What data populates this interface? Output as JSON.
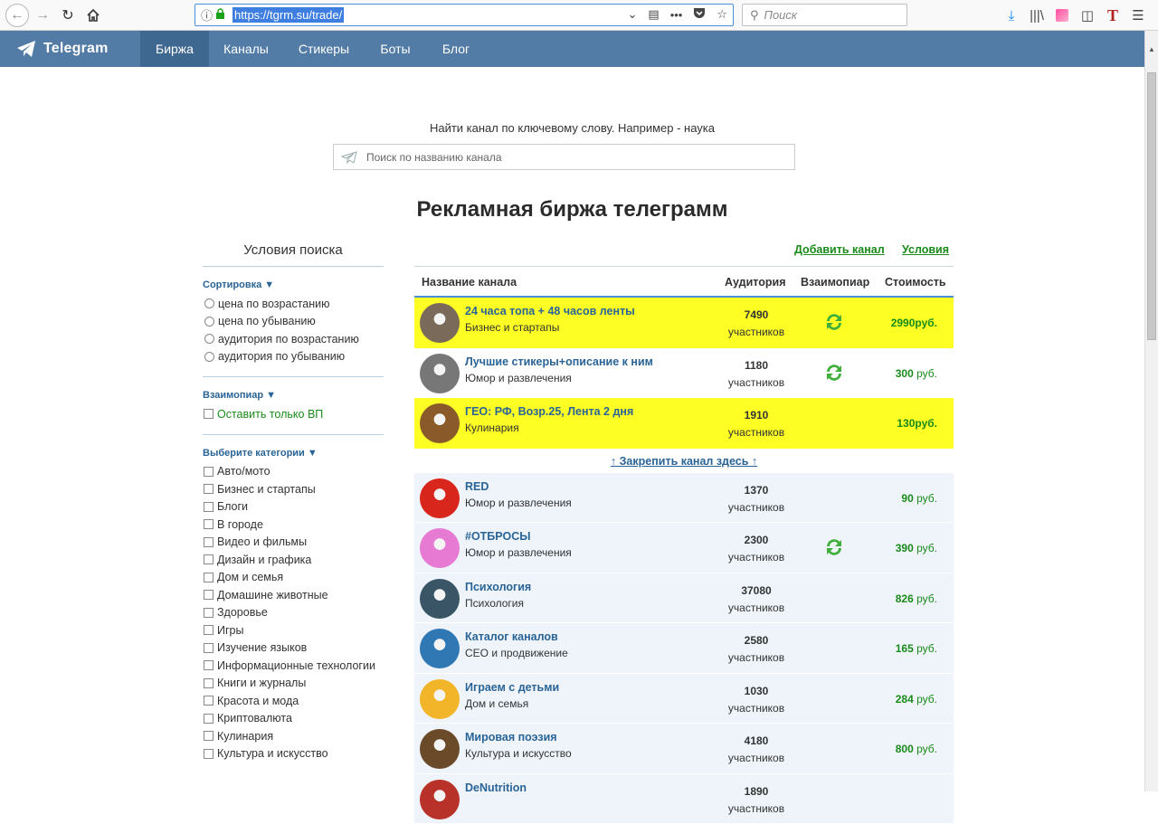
{
  "browser": {
    "url": "https://tgrm.su/trade/",
    "search_placeholder": "Поиск"
  },
  "site": {
    "brand": "Telegram",
    "nav": [
      "Биржа",
      "Каналы",
      "Стикеры",
      "Боты",
      "Блог"
    ],
    "active_nav": "Биржа"
  },
  "search": {
    "hint": "Найти канал по ключевому слову. Например - наука",
    "placeholder": "Поиск по названию канала"
  },
  "page_title": "Рекламная биржа телеграмм",
  "sidebar": {
    "title": "Условия поиска",
    "sort_title": "Сортировка ▼",
    "sort_options": [
      "цена по возрастанию",
      "цена по убыванию",
      "аудитория по возрастанию",
      "аудитория по убыванию"
    ],
    "vp_title": "Взаимопиар ▼",
    "vp_option": "Оставить только ВП",
    "cat_title": "Выберите категории ▼",
    "categories": [
      "Авто/мото",
      "Бизнес и стартапы",
      "Блоги",
      "В городе",
      "Видео и фильмы",
      "Дизайн и графика",
      "Дом и семья",
      "Домашине животные",
      "Здоровье",
      "Игры",
      "Изучение языков",
      "Информационные технологии",
      "Книги и журналы",
      "Красота и мода",
      "Криптовалюта",
      "Кулинария",
      "Культура и искусство"
    ]
  },
  "main": {
    "add_channel": "Добавить канал",
    "conditions": "Условия",
    "headers": {
      "name": "Название канала",
      "audience": "Аудитория",
      "vp": "Взаимопиар",
      "cost": "Стоимость"
    },
    "members_label": "участников",
    "pin_link": "↑ Закрепить канал здесь ↑",
    "currency_bold": "руб.",
    "currency": "руб.",
    "pinned": [
      {
        "name": "24 часа топа + 48 часов ленты",
        "category": "Бизнес и стартапы",
        "audience": "7490",
        "vp": true,
        "price": "2990",
        "avatar_color": "#7a6a5a"
      },
      {
        "name": "Лучшие стикеры+описание к ним",
        "category": "Юмор и развлечения",
        "audience": "1180",
        "vp": true,
        "price": "300",
        "avatar_color": "#777777"
      },
      {
        "name": "ГЕО: РФ, Возр.25, Лента 2 дня",
        "category": "Кулинария",
        "audience": "1910",
        "vp": false,
        "price": "130",
        "avatar_color": "#8a5a2a"
      }
    ],
    "rows": [
      {
        "name": "RED",
        "category": "Юмор и развлечения",
        "audience": "1370",
        "vp": false,
        "price": "90",
        "avatar_color": "#d9261c"
      },
      {
        "name": "#ОТБРОСЫ",
        "category": "Юмор и развлечения",
        "audience": "2300",
        "vp": true,
        "price": "390",
        "avatar_color": "#e77bd3"
      },
      {
        "name": "Психология",
        "category": "Психология",
        "audience": "37080",
        "vp": false,
        "price": "826",
        "avatar_color": "#3a5566"
      },
      {
        "name": "Каталог каналов",
        "category": "СЕО и продвижение",
        "audience": "2580",
        "vp": false,
        "price": "165",
        "avatar_color": "#2f78b4"
      },
      {
        "name": "Играем с детьми",
        "category": "Дом и семья",
        "audience": "1030",
        "vp": false,
        "price": "284",
        "avatar_color": "#f2b52a"
      },
      {
        "name": "Мировая поэзия",
        "category": "Культура и искусство",
        "audience": "4180",
        "vp": false,
        "price": "800",
        "avatar_color": "#6b4a2a"
      },
      {
        "name": "DeNutrition",
        "category": "",
        "audience": "1890",
        "vp": false,
        "price": "",
        "avatar_color": "#b8322a"
      }
    ]
  }
}
